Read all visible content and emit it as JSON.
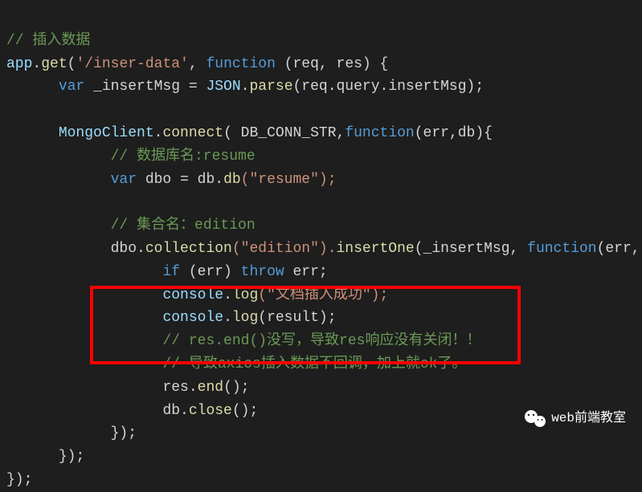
{
  "code": {
    "line1_comment": "// 插入数据",
    "line2_app": "app",
    "line2_get": "get",
    "line2_route": "'/inser-data'",
    "line2_function": "function",
    "line2_params": " (req, res) {",
    "line3_var": "var",
    "line3_insertMsg": " _insertMsg = ",
    "line3_json": "JSON",
    "line3_parse": "parse",
    "line3_reqquery": "(req.query.insertMsg);",
    "line5_mongo": "MongoClient",
    "line5_connect": "connect",
    "line5_dbconn": "( DB_CONN_STR,",
    "line5_function": "function",
    "line5_errdb": "(err,db){",
    "line6_comment": "// 数据库名:resume",
    "line7_var": "var",
    "line7_dbo": " dbo = db.",
    "line7_db": "db",
    "line7_resume": "(\"resume\");",
    "line9_comment": "// 集合名：edition",
    "line10_dbo": "dbo.",
    "line10_collection": "collection",
    "line10_edition": "(\"edition\").",
    "line10_insertOne": "insertOne",
    "line10_insertMsg": "(_insertMsg, ",
    "line10_function": "function",
    "line10_errresult": "(err, result){",
    "line11_if": "if",
    "line11_err": " (err) ",
    "line11_throw": "throw",
    "line11_errend": " err;",
    "line12_console": "console",
    "line12_log": "log",
    "line12_str": "(\"文档插入成功\");",
    "line13_console": "console",
    "line13_log": "log",
    "line13_result": "(result);",
    "line14_comment": "// res.end()没写，导致res响应没有关闭！！",
    "line15_comment": "// 导致axios插入数据不回调，加上就ok了。",
    "line16_res": "res.",
    "line16_end": "end",
    "line16_paren": "();",
    "line17_db": "db.",
    "line17_close": "close",
    "line17_paren": "();",
    "line18": "});",
    "line19": "});",
    "line20": "});"
  },
  "watermark": {
    "text": "web前端教室"
  }
}
